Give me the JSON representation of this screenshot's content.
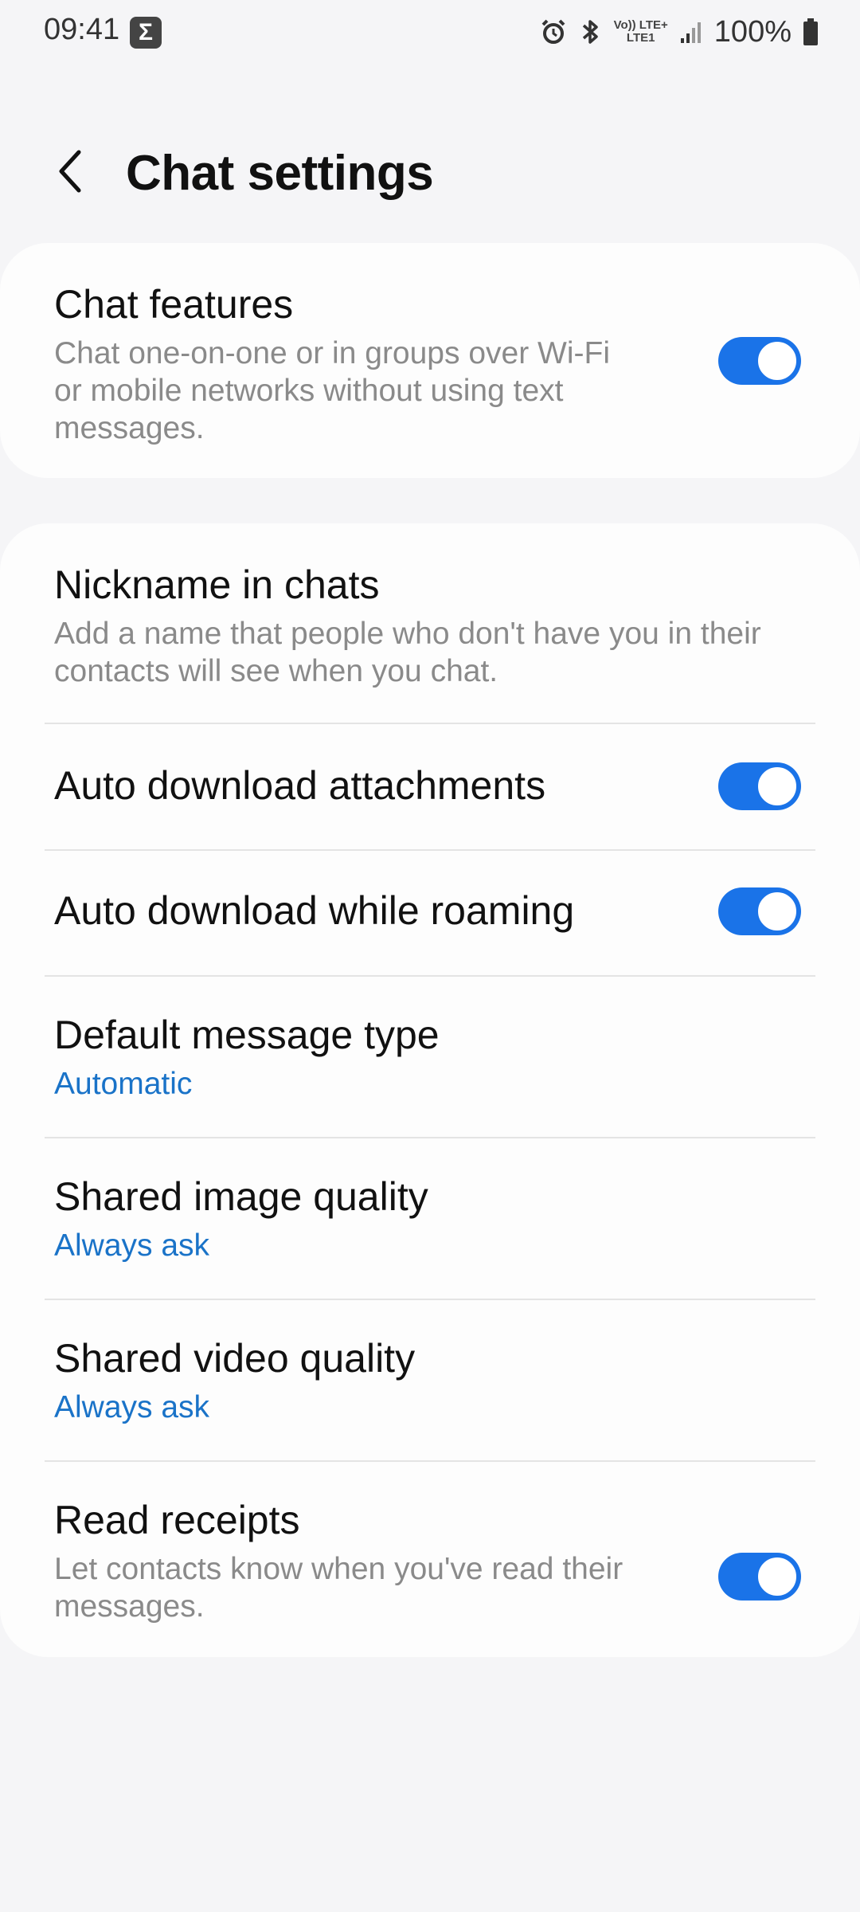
{
  "status_bar": {
    "time": "09:41",
    "notification_badge": "Σ",
    "network_top": "Vo)) LTE+",
    "network_bottom": "LTE1",
    "battery": "100%",
    "icons": [
      "alarm-icon",
      "bluetooth-icon",
      "signal-icon",
      "battery-icon"
    ]
  },
  "header": {
    "back_icon": "chevron-left-icon",
    "title": "Chat settings"
  },
  "chat_features": {
    "title": "Chat features",
    "description": "Chat one-on-one or in groups over Wi-Fi or mobile networks without using text messages.",
    "enabled": true
  },
  "settings": {
    "nickname": {
      "title": "Nickname in chats",
      "description": "Add a name that people who don't have you in their contacts will see when you chat."
    },
    "auto_download_attachments": {
      "title": "Auto download attachments",
      "enabled": true
    },
    "auto_download_roaming": {
      "title": "Auto download while roaming",
      "enabled": true
    },
    "default_message_type": {
      "title": "Default message type",
      "value": "Automatic"
    },
    "shared_image_quality": {
      "title": "Shared image quality",
      "value": "Always ask"
    },
    "shared_video_quality": {
      "title": "Shared video quality",
      "value": "Always ask"
    },
    "read_receipts": {
      "title": "Read receipts",
      "description": "Let contacts know when you've read their messages.",
      "enabled": true
    }
  },
  "colors": {
    "accent": "#1a73e8",
    "link": "#1a73c8",
    "background": "#f5f5f7",
    "card": "#fdfdfd",
    "secondary_text": "#8a8a8a"
  }
}
